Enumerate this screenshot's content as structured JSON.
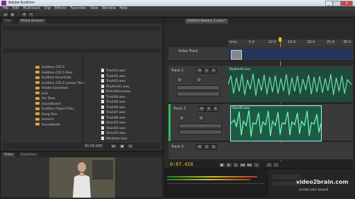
{
  "window": {
    "title": "Adobe Audition",
    "controls": {
      "minimize": "_",
      "maximize": "□",
      "close": "✕"
    }
  },
  "menubar": [
    "File",
    "Edit",
    "Multitrack",
    "Clip",
    "Effects",
    "Favorites",
    "View",
    "Window",
    "Help"
  ],
  "files_panel": {
    "tabs": [
      "Files",
      "Media Browser"
    ],
    "tree": [
      "Audition CS5.5",
      "Audition CS5.5 Files",
      "Audition Essentials",
      "Audition CS5.5 Lesson Files",
      "Adobe Essentials",
      "Jack",
      "Pro Tools",
      "Soundboard",
      "Audition Project Files",
      "Song Files",
      "Lessons",
      "Soundbooth"
    ],
    "files": [
      "Track01.wav",
      "Track02.wav",
      "Track03.wav",
      "Rhythm01.wav",
      "DirectStory.wav",
      "Track04.wav",
      "Track05.wav",
      "Track06.wav",
      "Track07.wav",
      "Track08.wav",
      "Voice01.wav",
      "Voice02.wav",
      "Voice03.wav",
      "Mixdown.wav"
    ],
    "footer_value": "00:00.000"
  },
  "multitrack": {
    "tab": "Untitled Session 1.sesx *",
    "ruler": [
      "hms",
      "5.0",
      "10.0",
      "15.0",
      "20.0",
      "25.0",
      "30.0"
    ],
    "tracks": [
      {
        "name": "Video Track"
      },
      {
        "name": "Track 1",
        "clip": "Rhythm01.wav"
      },
      {
        "name": "Track 2",
        "clip": "Voice01.wav"
      },
      {
        "name": "Track 3"
      }
    ],
    "timecode": "0:07.416"
  },
  "video_panel": {
    "tabs": [
      "Video",
      "Properties"
    ]
  },
  "bottom_right": {
    "watermark": "video2brain.com",
    "footer": "lynda.com brand"
  }
}
